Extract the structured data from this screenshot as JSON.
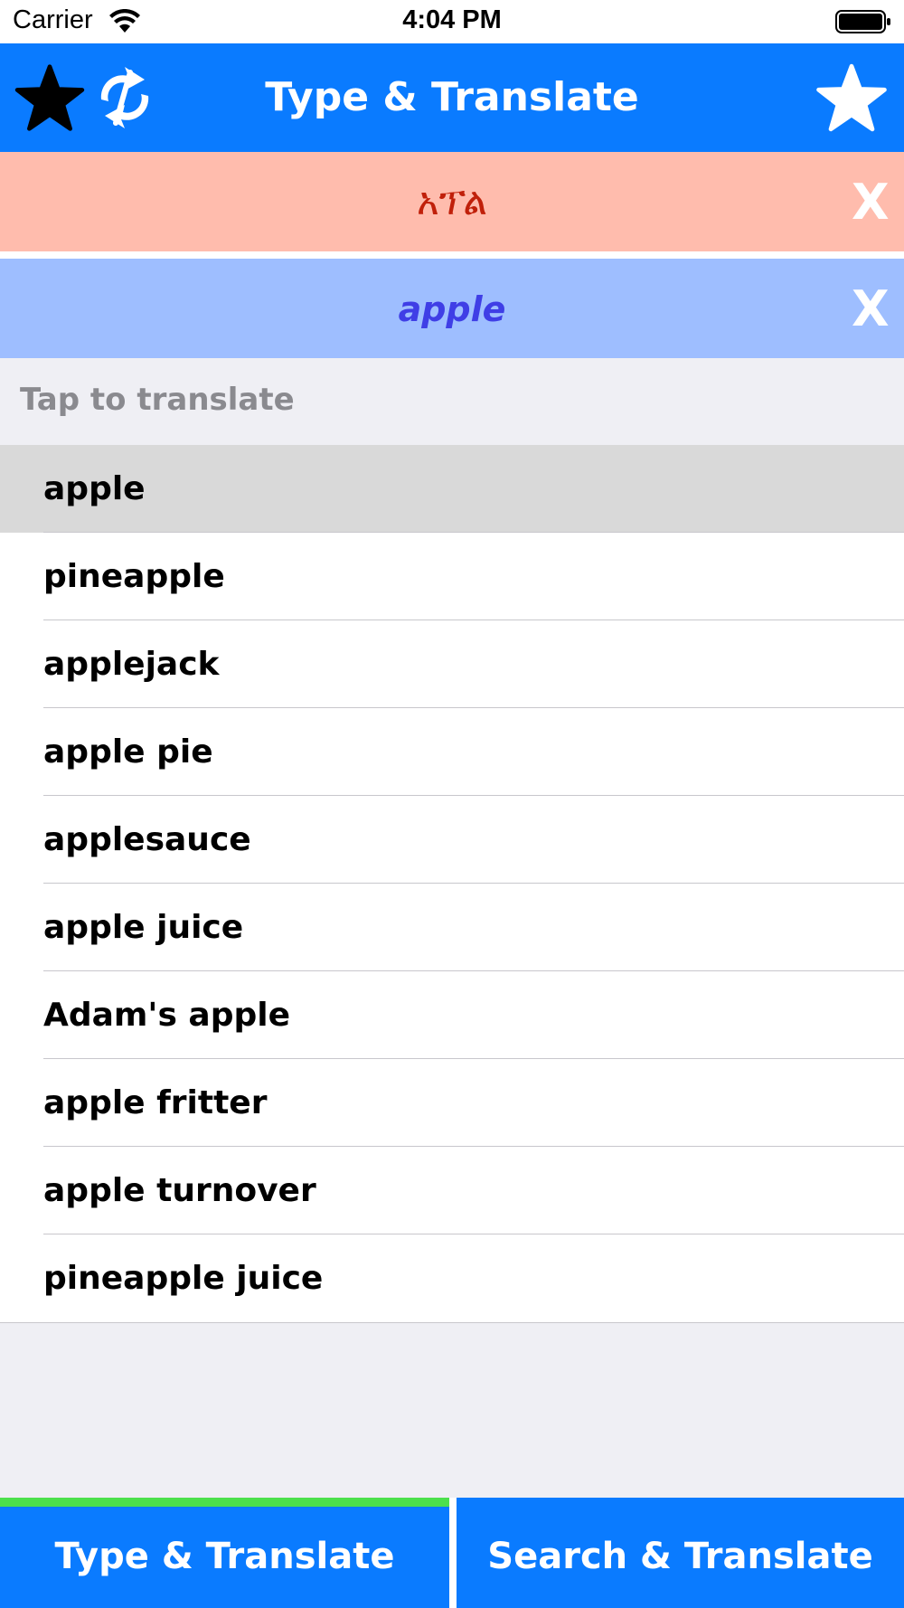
{
  "status_bar": {
    "carrier": "Carrier",
    "time": "4:04 PM"
  },
  "nav": {
    "title": "Type & Translate",
    "left_icons": [
      "star-icon",
      "sync-icon"
    ],
    "right_icon": "star-outline-icon"
  },
  "translation": {
    "source_text": "አፕል",
    "target_text": "apple",
    "clear_label": "X"
  },
  "suggestions": {
    "header": "Tap to translate",
    "items": [
      "apple",
      "pineapple",
      "applejack",
      "apple pie",
      "applesauce",
      "apple juice",
      "Adam's apple",
      "apple fritter",
      "apple turnover",
      "pineapple juice"
    ],
    "selected_index": 0
  },
  "tabs": [
    {
      "label": "Type & Translate",
      "active": true
    },
    {
      "label": "Search & Translate",
      "active": false
    }
  ],
  "colors": {
    "accent": "#0a7bff",
    "source_panel": "#ffbcad",
    "target_panel": "#9ebeff",
    "active_tab_indicator": "#4ce04c"
  }
}
